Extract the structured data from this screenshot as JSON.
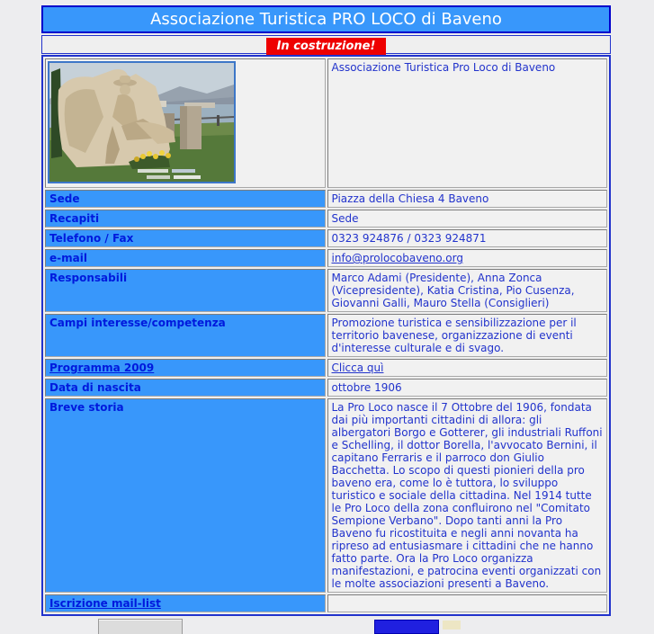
{
  "header": {
    "title": "Associazione Turistica PRO LOCO di Baveno",
    "construction_banner": "In costruzione!"
  },
  "info_table": {
    "rows": [
      {
        "label": "",
        "value": "Associazione Turistica Pro Loco di Baveno"
      },
      {
        "label": "Sede",
        "value": "Piazza della Chiesa 4  Baveno"
      },
      {
        "label": "Recapiti",
        "value": "Sede"
      },
      {
        "label": "Telefono / Fax",
        "value": "0323 924876 /  0323 924871"
      },
      {
        "label": "e-mail",
        "value": "info@prolocobaveno.org"
      },
      {
        "label": "Responsabili",
        "value": "Marco Adami (Presidente), Anna Zonca (Vicepresidente), Katia Cristina, Pio Cusenza, Giovanni Galli, Mauro Stella (Consiglieri)"
      },
      {
        "label": "Campi interesse/competenza",
        "value": "Promozione turistica e sensibilizzazione per il territorio bavenese, organizzazione di eventi d'interesse culturale e di svago."
      },
      {
        "label": "Programma 2009",
        "value": "Clicca quì"
      },
      {
        "label": "Data di nascita",
        "value": "ottobre 1906"
      },
      {
        "label": "Breve storia",
        "value": "La Pro Loco nasce il 7 Ottobre del 1906, fondata dai più importanti cittadini di allora: gli albergatori Borgo e Gotterer, gli industriali Ruffoni e Schelling, il dottor Borella, l'avvocato Bernini, il capitano Ferraris e il parroco don Giulio Bacchetta. Lo scopo di questi pionieri della pro baveno era, come lo è tuttora, lo sviluppo turistico e sociale della cittadina. Nel 1914 tutte le Pro Loco della zona confluirono nel \"Comitato Sempione Verbano\". Dopo tanti anni la Pro Baveno fu ricostituita e negli anni novanta ha ripreso ad entusiasmare i cittadini che ne hanno fatto parte. Ora la Pro Loco organizza manifestazioni, e patrocina eventi organizzati con le molte associazioni presenti a Baveno."
      },
      {
        "label": "Iscrizione mail-list",
        "value": ""
      }
    ]
  },
  "colors": {
    "header_blue": "#3897FB",
    "border_blue": "#0000CC",
    "text_blue": "#2233CC",
    "banner_red": "#EE0000",
    "page_background": "#EDEDEF"
  }
}
